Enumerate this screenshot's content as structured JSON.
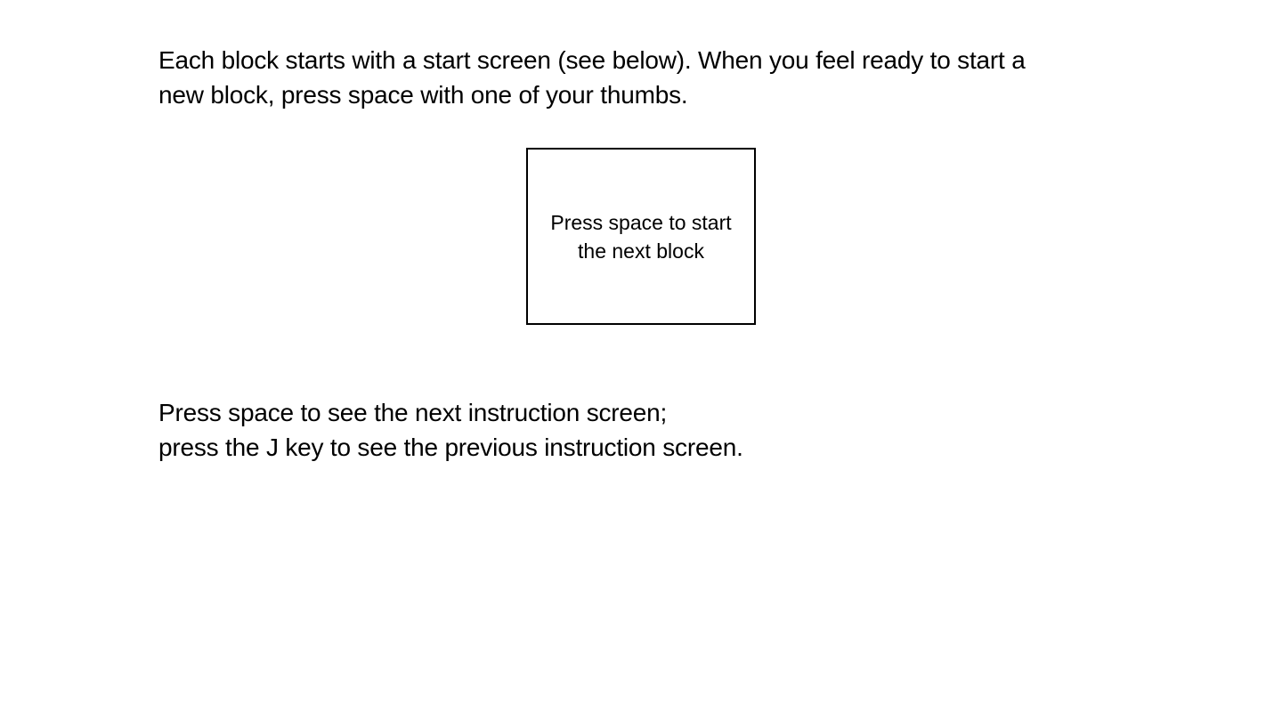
{
  "intro": {
    "line1": "Each block starts with a start screen (see below). When you feel ready to start a",
    "line2": "new block, press space with one of your thumbs."
  },
  "start_screen_example": {
    "line1": "Press space to start",
    "line2": "the next block"
  },
  "navigation": {
    "line1": "Press space to see the next instruction screen;",
    "line2": "press the J key to see the previous instruction screen."
  }
}
